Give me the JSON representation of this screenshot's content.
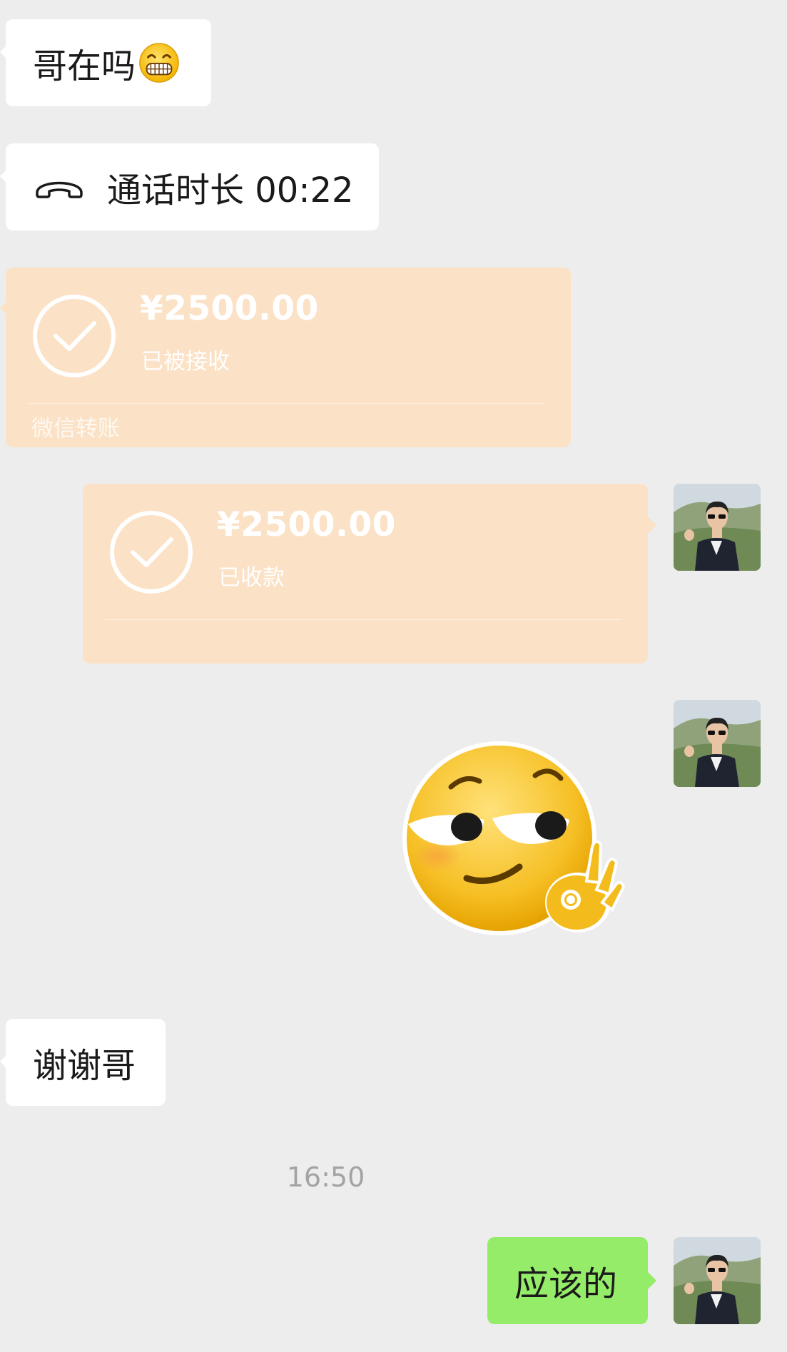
{
  "messages": {
    "greeting": {
      "text": "哥在吗",
      "emoji": "grinning-face-emoji"
    },
    "call": {
      "icon": "phone-hangup-icon",
      "text": "通话时长 00:22"
    },
    "transfer_received": {
      "amount": "¥2500.00",
      "status": "已被接收",
      "source": "微信转账",
      "icon": "check-circle-icon"
    },
    "transfer_sent": {
      "amount": "¥2500.00",
      "status": "已收款",
      "icon": "check-circle-icon"
    },
    "sticker": {
      "name": "smirk-ok-hand-sticker"
    },
    "thanks": {
      "text": "谢谢哥"
    },
    "timestamp": "16:50",
    "reply": {
      "text": "应该的"
    }
  },
  "colors": {
    "background": "#ededed",
    "incoming_bubble": "#ffffff",
    "outgoing_bubble": "#95ec69",
    "transfer_card": "#fbe2c6",
    "timestamp_text": "#a3a3a3"
  }
}
